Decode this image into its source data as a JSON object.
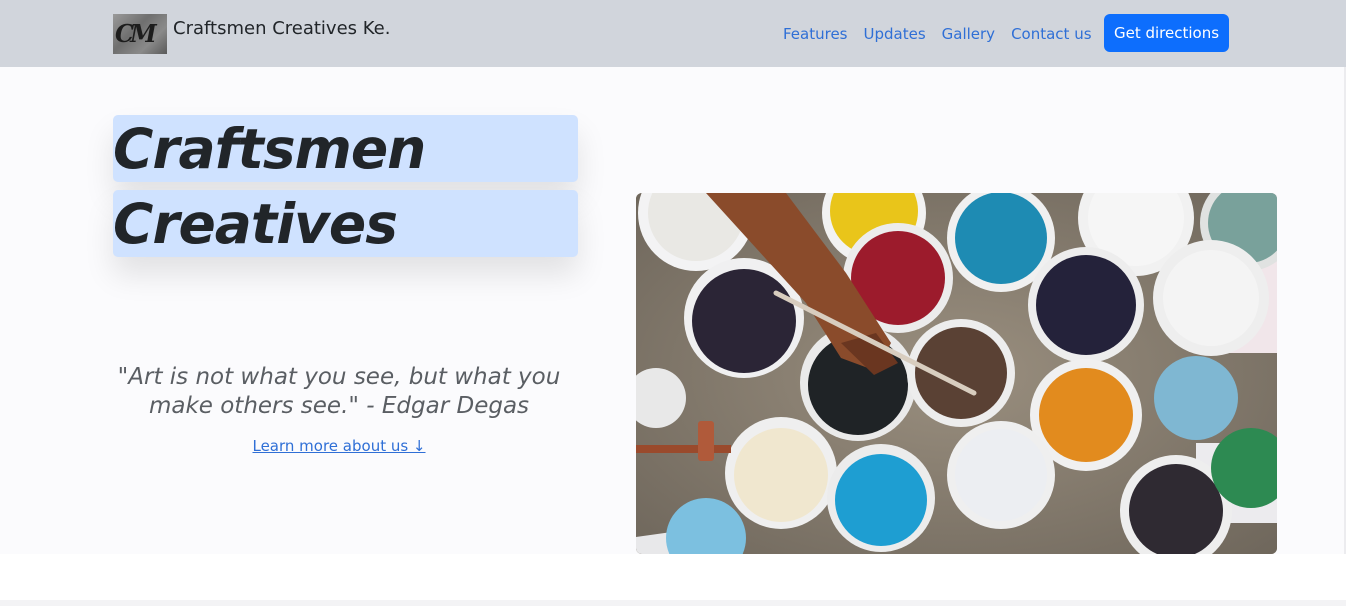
{
  "brand": {
    "name": "Craftsmen Creatives Ke.",
    "logo_text": "CM"
  },
  "nav": {
    "links": [
      "Features",
      "Updates",
      "Gallery",
      "Contact us"
    ],
    "cta": "Get directions"
  },
  "hero": {
    "title_line1": "Craftsmen",
    "title_line2": "Creatives",
    "quote": "\"Art is not what you see, but what you make others see.\" - Edgar Degas",
    "learn_more": "Learn more about us ↓",
    "image_subject": "paint-buckets-photo"
  },
  "colors": {
    "navbar_bg": "#d1d5dc",
    "primary": "#0d6efd",
    "title_highlight": "#cfe2ff",
    "link": "#2f6fd6"
  }
}
